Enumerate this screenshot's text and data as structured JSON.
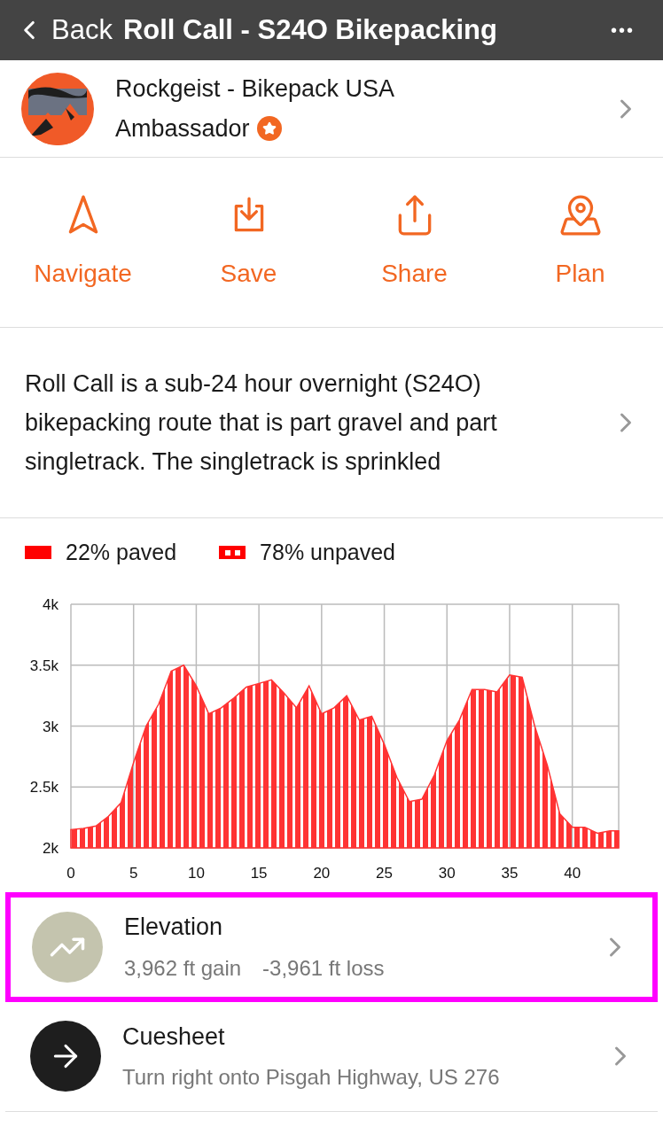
{
  "nav_bar": {
    "back_label": "Back",
    "title": "Roll Call - S24O Bikepacking",
    "more": "•••"
  },
  "owner": {
    "name": "Rockgeist - Bikepack USA",
    "role": "Ambassador"
  },
  "actions": [
    {
      "kind": "navigate",
      "label": "Navigate"
    },
    {
      "kind": "save",
      "label": "Save"
    },
    {
      "kind": "share",
      "label": "Share"
    },
    {
      "kind": "plan",
      "label": "Plan"
    }
  ],
  "description": "Roll Call is a sub-24 hour overnight (S24O) bikepacking route that is part gravel and part singletrack. The singletrack is sprinkled",
  "surface_legend": [
    {
      "kind": "solid",
      "label": "22% paved"
    },
    {
      "kind": "dashed",
      "label": "78% unpaved"
    }
  ],
  "elevation_chart": {
    "chart_data": {
      "type": "area",
      "x": [
        0,
        1,
        2,
        3,
        4,
        5,
        6,
        7,
        8,
        9,
        10,
        11,
        12,
        13,
        14,
        15,
        16,
        17,
        18,
        19,
        20,
        21,
        22,
        23,
        24,
        25,
        26,
        27,
        28,
        29,
        30,
        31,
        32,
        33,
        34,
        35,
        36,
        37,
        38,
        39,
        40,
        41,
        42,
        43,
        43.7
      ],
      "grid": true,
      "series": [
        {
          "color": "#ff3333",
          "values": [
            2150,
            2160,
            2180,
            2260,
            2370,
            2700,
            3000,
            3180,
            3450,
            3500,
            3330,
            3100,
            3150,
            3230,
            3320,
            3350,
            3380,
            3270,
            3150,
            3330,
            3100,
            3150,
            3250,
            3050,
            3080,
            2850,
            2580,
            2380,
            2400,
            2600,
            2880,
            3050,
            3300,
            3300,
            3280,
            3420,
            3400,
            3000,
            2680,
            2280,
            2170,
            2170,
            2120,
            2140,
            2140
          ]
        }
      ],
      "xlim": [
        0,
        43.7
      ],
      "ylim": [
        2000,
        4000
      ],
      "xticks": [
        0,
        5,
        10,
        15,
        20,
        25,
        30,
        35,
        40
      ],
      "yticks": [
        {
          "value": 2000,
          "label": "2k"
        },
        {
          "value": 2500,
          "label": "2.5k"
        },
        {
          "value": 3000,
          "label": "3k"
        },
        {
          "value": 3500,
          "label": "3.5k"
        },
        {
          "value": 4000,
          "label": "4k"
        }
      ]
    }
  },
  "detail_rows": [
    {
      "kind": "elevation",
      "title": "Elevation",
      "subtitles": [
        "3,962 ft gain",
        "-3,961 ft loss"
      ],
      "highlighted": true
    },
    {
      "kind": "cuesheet",
      "title": "Cuesheet",
      "subtitles": [
        "Turn right onto Pisgah Highway, US 276"
      ],
      "highlighted": false
    }
  ]
}
